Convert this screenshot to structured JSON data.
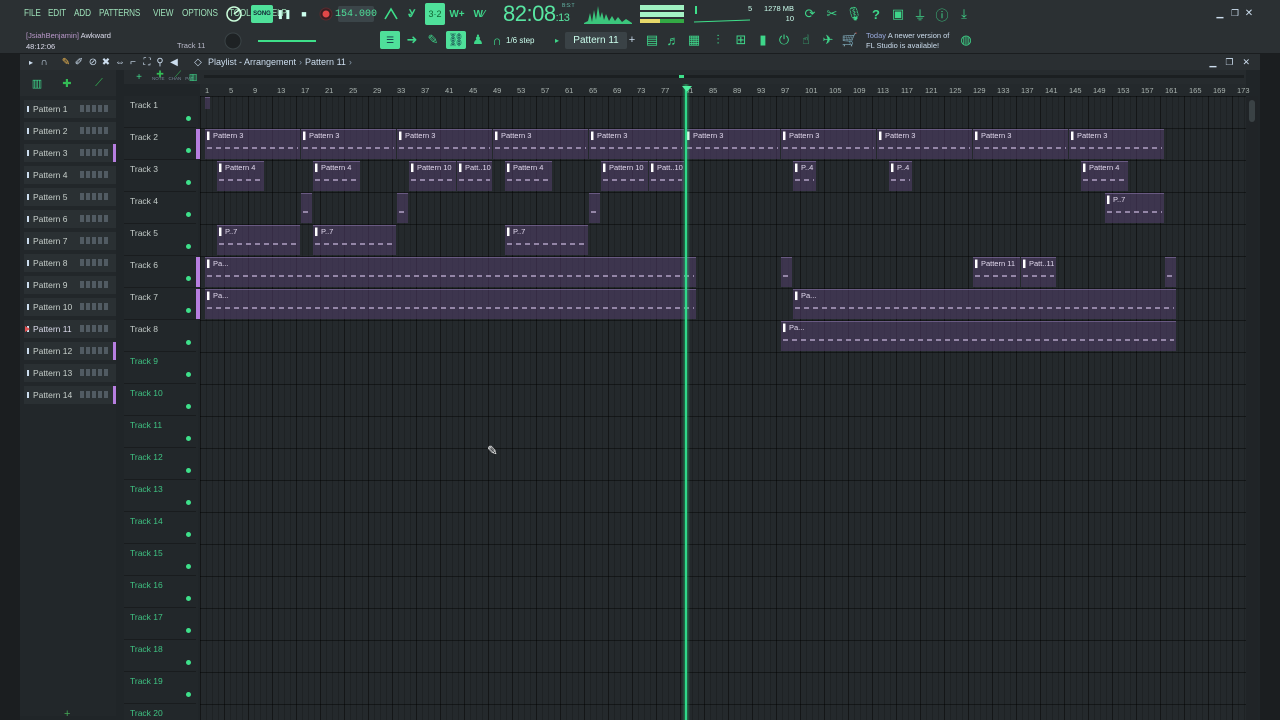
{
  "menu": [
    "FILE",
    "EDIT",
    "ADD",
    "PATTERNS",
    "VIEW",
    "OPTIONS",
    "TOOLS",
    "HELP"
  ],
  "transport": {
    "song_label": "SONG",
    "tempo": "154.000",
    "time": "82:08",
    "time_small": "13",
    "time_units": "B:S:T",
    "cpu": "5",
    "ram": "1278 MB",
    "poly": "10"
  },
  "hint": {
    "user": "[JsiahBenjamin]",
    "song": "Awkward",
    "time": "48:12:06",
    "track": "Track 11",
    "snap": "1/6 step",
    "pattern": "Pattern 11",
    "news_when": "Today",
    "news_text_1": "A newer version of",
    "news_text_2": "FL Studio is available!"
  },
  "playlist": {
    "breadcrumb_1": "Playlist - Arrangement",
    "breadcrumb_2": "Pattern 11",
    "ruler_small": [
      "NOTE",
      "CHAN",
      "PAT"
    ]
  },
  "patterns": [
    "Pattern 1",
    "Pattern 2",
    "Pattern 3",
    "Pattern 4",
    "Pattern 5",
    "Pattern 6",
    "Pattern 7",
    "Pattern 8",
    "Pattern 9",
    "Pattern 10",
    "Pattern 11",
    "Pattern 12",
    "Pattern 13",
    "Pattern 14"
  ],
  "active_pattern_index": 10,
  "purple_marked_patterns": [
    2,
    11,
    13
  ],
  "tracks": [
    "Track 1",
    "Track 2",
    "Track 3",
    "Track 4",
    "Track 5",
    "Track 6",
    "Track 7",
    "Track 8",
    "Track 9",
    "Track 10",
    "Track 11",
    "Track 12",
    "Track 13",
    "Track 14",
    "Track 15",
    "Track 16",
    "Track 17",
    "Track 18",
    "Track 19",
    "Track 20"
  ],
  "bar_numbers": [
    1,
    5,
    9,
    13,
    17,
    21,
    25,
    29,
    33,
    37,
    41,
    45,
    49,
    53,
    57,
    61,
    65,
    69,
    73,
    77,
    81,
    85,
    89,
    93,
    97,
    101,
    105,
    109,
    113,
    117,
    121,
    125,
    129,
    133,
    137,
    141,
    145,
    149,
    153,
    157,
    161,
    165,
    169,
    173
  ],
  "colors": {
    "accent": "#3ee08a",
    "clip": "#52406c",
    "selection": "#b77ee0",
    "background": "#24292c"
  },
  "clips": [
    {
      "track": 1,
      "start": 1,
      "end": 2,
      "label": ""
    },
    {
      "track": 2,
      "start": 1,
      "end": 17,
      "label": "Pattern 3"
    },
    {
      "track": 2,
      "start": 17,
      "end": 33,
      "label": "Pattern 3"
    },
    {
      "track": 2,
      "start": 33,
      "end": 49,
      "label": "Pattern 3"
    },
    {
      "track": 2,
      "start": 49,
      "end": 65,
      "label": "Pattern 3"
    },
    {
      "track": 2,
      "start": 65,
      "end": 81,
      "label": "Pattern 3"
    },
    {
      "track": 2,
      "start": 81,
      "end": 97,
      "label": "Pattern 3"
    },
    {
      "track": 2,
      "start": 97,
      "end": 113,
      "label": "Pattern 3"
    },
    {
      "track": 2,
      "start": 113,
      "end": 129,
      "label": "Pattern 3"
    },
    {
      "track": 2,
      "start": 129,
      "end": 145,
      "label": "Pattern 3"
    },
    {
      "track": 2,
      "start": 145,
      "end": 161,
      "label": "Pattern 3"
    },
    {
      "track": 3,
      "start": 3,
      "end": 11,
      "label": "Pattern 4"
    },
    {
      "track": 3,
      "start": 19,
      "end": 27,
      "label": "Pattern 4"
    },
    {
      "track": 3,
      "start": 35,
      "end": 43,
      "label": "Pattern 10"
    },
    {
      "track": 3,
      "start": 43,
      "end": 49,
      "label": "Patt..10"
    },
    {
      "track": 3,
      "start": 51,
      "end": 59,
      "label": "Pattern 4"
    },
    {
      "track": 3,
      "start": 67,
      "end": 75,
      "label": "Pattern 10"
    },
    {
      "track": 3,
      "start": 75,
      "end": 81,
      "label": "Patt..10"
    },
    {
      "track": 3,
      "start": 99,
      "end": 103,
      "label": "P..4"
    },
    {
      "track": 3,
      "start": 115,
      "end": 119,
      "label": "P..4"
    },
    {
      "track": 3,
      "start": 147,
      "end": 155,
      "label": "Pattern 4"
    },
    {
      "track": 4,
      "start": 17,
      "end": 19,
      "label": ""
    },
    {
      "track": 4,
      "start": 33,
      "end": 35,
      "label": ""
    },
    {
      "track": 4,
      "start": 65,
      "end": 67,
      "label": ""
    },
    {
      "track": 4,
      "start": 151,
      "end": 161,
      "label": "P..7"
    },
    {
      "track": 5,
      "start": 3,
      "end": 17,
      "label": "P..7"
    },
    {
      "track": 5,
      "start": 19,
      "end": 33,
      "label": "P..7"
    },
    {
      "track": 5,
      "start": 51,
      "end": 65,
      "label": "P..7"
    },
    {
      "track": 6,
      "start": 1,
      "end": 83,
      "label": "Pa..."
    },
    {
      "track": 6,
      "start": 97,
      "end": 99,
      "label": ""
    },
    {
      "track": 6,
      "start": 129,
      "end": 137,
      "label": "Pattern 11"
    },
    {
      "track": 6,
      "start": 137,
      "end": 143,
      "label": "Patt..11"
    },
    {
      "track": 6,
      "start": 161,
      "end": 163,
      "label": ""
    },
    {
      "track": 7,
      "start": 1,
      "end": 83,
      "label": "Pa..."
    },
    {
      "track": 7,
      "start": 99,
      "end": 163,
      "label": "Pa..."
    },
    {
      "track": 8,
      "start": 97,
      "end": 163,
      "label": "Pa..."
    }
  ]
}
